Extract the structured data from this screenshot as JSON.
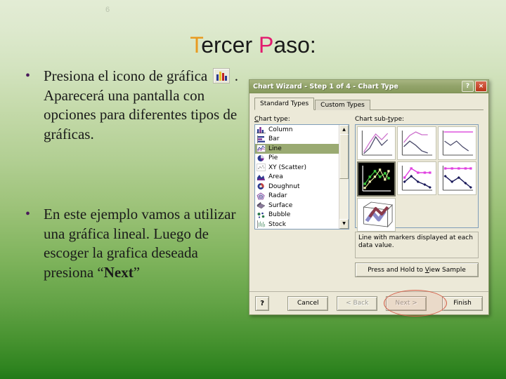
{
  "slide": {
    "page_number": "6",
    "title": {
      "full": "Tercer Paso:",
      "seg1_cap": "T",
      "seg1_rest": "ercer ",
      "seg2_cap": "P",
      "seg2_rest": "aso:"
    },
    "accent_orange": "#e89a20",
    "accent_pink": "#e21a6e",
    "background_top": "#e3ecd5",
    "background_bottom": "#227a18",
    "bullets": [
      {
        "marker": "•",
        "part1": "Presiona el icono de gráfica ",
        "icon": "bar-chart-icon",
        "part2": " .  Aparecerá una pantalla con opciones para diferentes tipos de gráficas."
      },
      {
        "marker": "•",
        "part1": "En este ejemplo vamos a utilizar una gráfica lineal. Luego de escoger la grafica deseada presiona “",
        "bold": "Next",
        "part2": "”"
      }
    ]
  },
  "dialog": {
    "title": "Chart Wizard - Step 1 of 4 - Chart Type",
    "titlebar_color": "#93a46b",
    "help_button": "?",
    "close_button": "×",
    "tabs": [
      {
        "label": "Standard Types",
        "active": true
      },
      {
        "label": "Custom Types",
        "active": false
      }
    ],
    "chart_type_label": "Chart type:",
    "chart_type_label_underline": "C",
    "chart_types": [
      {
        "label": "Column",
        "icon": "column-chart-icon",
        "selected": false
      },
      {
        "label": "Bar",
        "icon": "bar-chart-icon",
        "selected": false
      },
      {
        "label": "Line",
        "icon": "line-chart-icon",
        "selected": true
      },
      {
        "label": "Pie",
        "icon": "pie-chart-icon",
        "selected": false
      },
      {
        "label": "XY (Scatter)",
        "icon": "scatter-chart-icon",
        "selected": false
      },
      {
        "label": "Area",
        "icon": "area-chart-icon",
        "selected": false
      },
      {
        "label": "Doughnut",
        "icon": "doughnut-chart-icon",
        "selected": false
      },
      {
        "label": "Radar",
        "icon": "radar-chart-icon",
        "selected": false
      },
      {
        "label": "Surface",
        "icon": "surface-chart-icon",
        "selected": false
      },
      {
        "label": "Bubble",
        "icon": "bubble-chart-icon",
        "selected": false
      },
      {
        "label": "Stock",
        "icon": "stock-chart-icon",
        "selected": false
      }
    ],
    "chart_subtype_label": "Chart sub-type:",
    "chart_subtypes": [
      {
        "name": "line",
        "selected": false
      },
      {
        "name": "stacked-line",
        "selected": false
      },
      {
        "name": "100-percent-stacked-line",
        "selected": false
      },
      {
        "name": "line-with-markers",
        "selected": true
      },
      {
        "name": "stacked-line-with-markers",
        "selected": false
      },
      {
        "name": "100-percent-stacked-line-with-markers",
        "selected": false
      },
      {
        "name": "3d-line",
        "selected": false
      }
    ],
    "subtype_description": "Line with markers displayed at each data value.",
    "view_sample_button": "Press and Hold to View Sample",
    "view_sample_underline": "V",
    "footer_buttons": [
      {
        "label": "Cancel",
        "name": "cancel-button",
        "disabled": false,
        "highlighted": false
      },
      {
        "label": "< Back",
        "name": "back-button",
        "disabled": true,
        "highlighted": false
      },
      {
        "label": "Next >",
        "name": "next-button",
        "disabled": true,
        "highlighted": true
      },
      {
        "label": "Finish",
        "name": "finish-button",
        "disabled": false,
        "highlighted": false
      }
    ],
    "highlight_color": "#d4604a"
  }
}
